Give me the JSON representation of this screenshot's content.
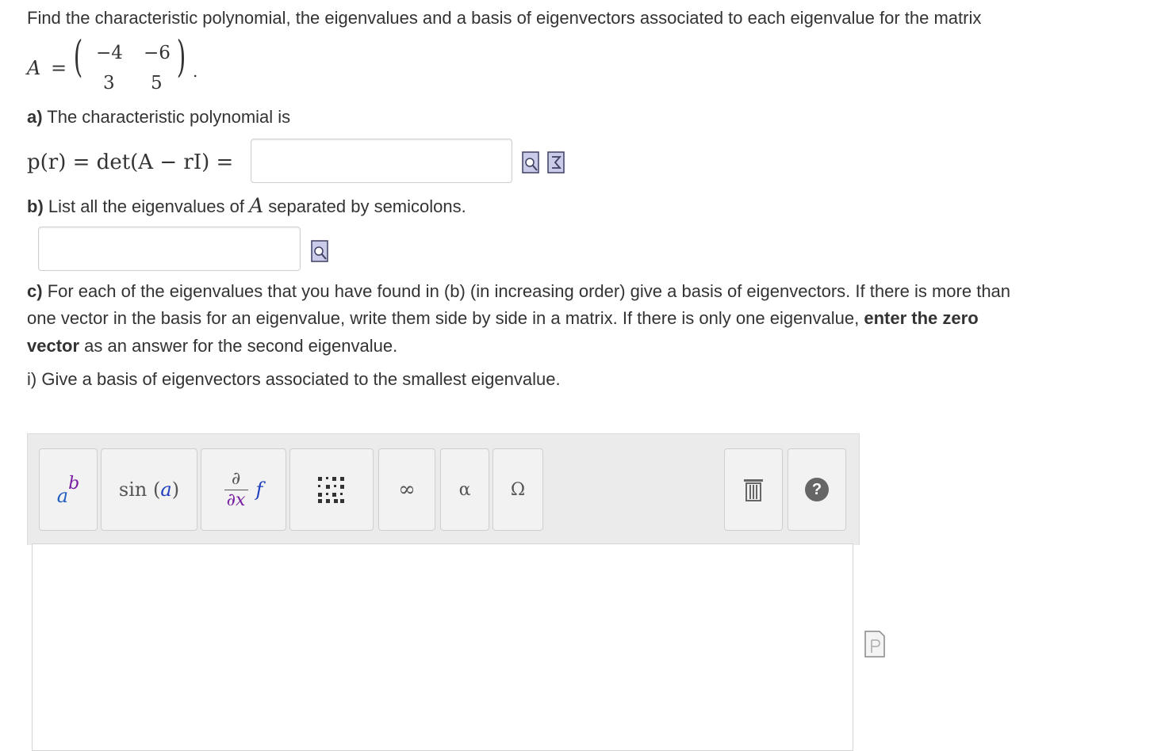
{
  "question": {
    "intro": "Find the characteristic polynomial, the eigenvalues and a basis of eigenvectors associated to each eigenvalue for the matrix",
    "matrix_name": "A",
    "matrix": [
      [
        "−4",
        "−6"
      ],
      [
        "3",
        "5"
      ]
    ]
  },
  "part_a": {
    "label": "a)",
    "text": "The characteristic polynomial is",
    "formula_lhs": "p(r) = det(A − rI) =",
    "answer_value": ""
  },
  "part_b": {
    "label": "b)",
    "text_before": "List all the eigenvalues of",
    "symbol": "A",
    "text_after": "separated by semicolons.",
    "answer_value": ""
  },
  "part_c": {
    "label": "c)",
    "line1": "For each of the eigenvalues that you have found in (b) (in increasing order) give a basis of eigenvectors. If there is more than",
    "line2_before": "one vector in the basis for an eigenvalue, write them side by side in a matrix. If there is only one eigenvalue,",
    "line2_bold": "enter the zero",
    "line3_bold": "vector",
    "line3_after": "as an answer for the second eigenvalue."
  },
  "part_ci": {
    "text": "i) Give a basis of eigenvectors associated to the smallest eigenvalue."
  },
  "toolbar": {
    "power_base": "a",
    "power_exp": "b",
    "sin_label": "sin",
    "sin_arg": "a",
    "deriv_num": "∂",
    "deriv_den": "∂x",
    "deriv_f": "f",
    "infinity": "∞",
    "alpha": "α",
    "omega": "Ω",
    "help": "?"
  },
  "colors": {
    "text": "#333333",
    "power_base": "#1f5fbf",
    "power_exp": "#7a1fa2",
    "sin_arg": "#1f3fbf",
    "deriv_f": "#1f3fbf",
    "deriv_x": "#7a1fa2",
    "icon_fill": "#c9cbe8",
    "icon_stroke": "#3d3f63",
    "help_bg": "#666666"
  }
}
